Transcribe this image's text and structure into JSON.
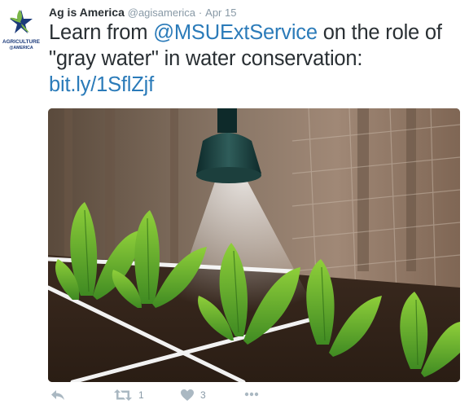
{
  "tweet": {
    "author_name": "Ag is America",
    "handle": "@agisamerica",
    "separator": "·",
    "date": "Apr 15",
    "text_before": "Learn from ",
    "mention": "@MSUExtService",
    "text_after": " on the role of \"gray water\" in water conservation: ",
    "link": "bit.ly/1SflZjf"
  },
  "avatar": {
    "line1": "AGRICULTURE",
    "line2": "@AMERICA",
    "colors": {
      "star_blue": "#1b3a7a",
      "star_green": "#7ab648"
    }
  },
  "actions": {
    "reply_icon": "reply-icon",
    "retweet_icon": "retweet-icon",
    "retweet_count": "1",
    "like_icon": "heart-icon",
    "like_count": "3",
    "more_icon": "more-icon"
  },
  "colors": {
    "link": "#2b7bb9",
    "muted": "#8899a6",
    "icon": "#aab8c2"
  }
}
